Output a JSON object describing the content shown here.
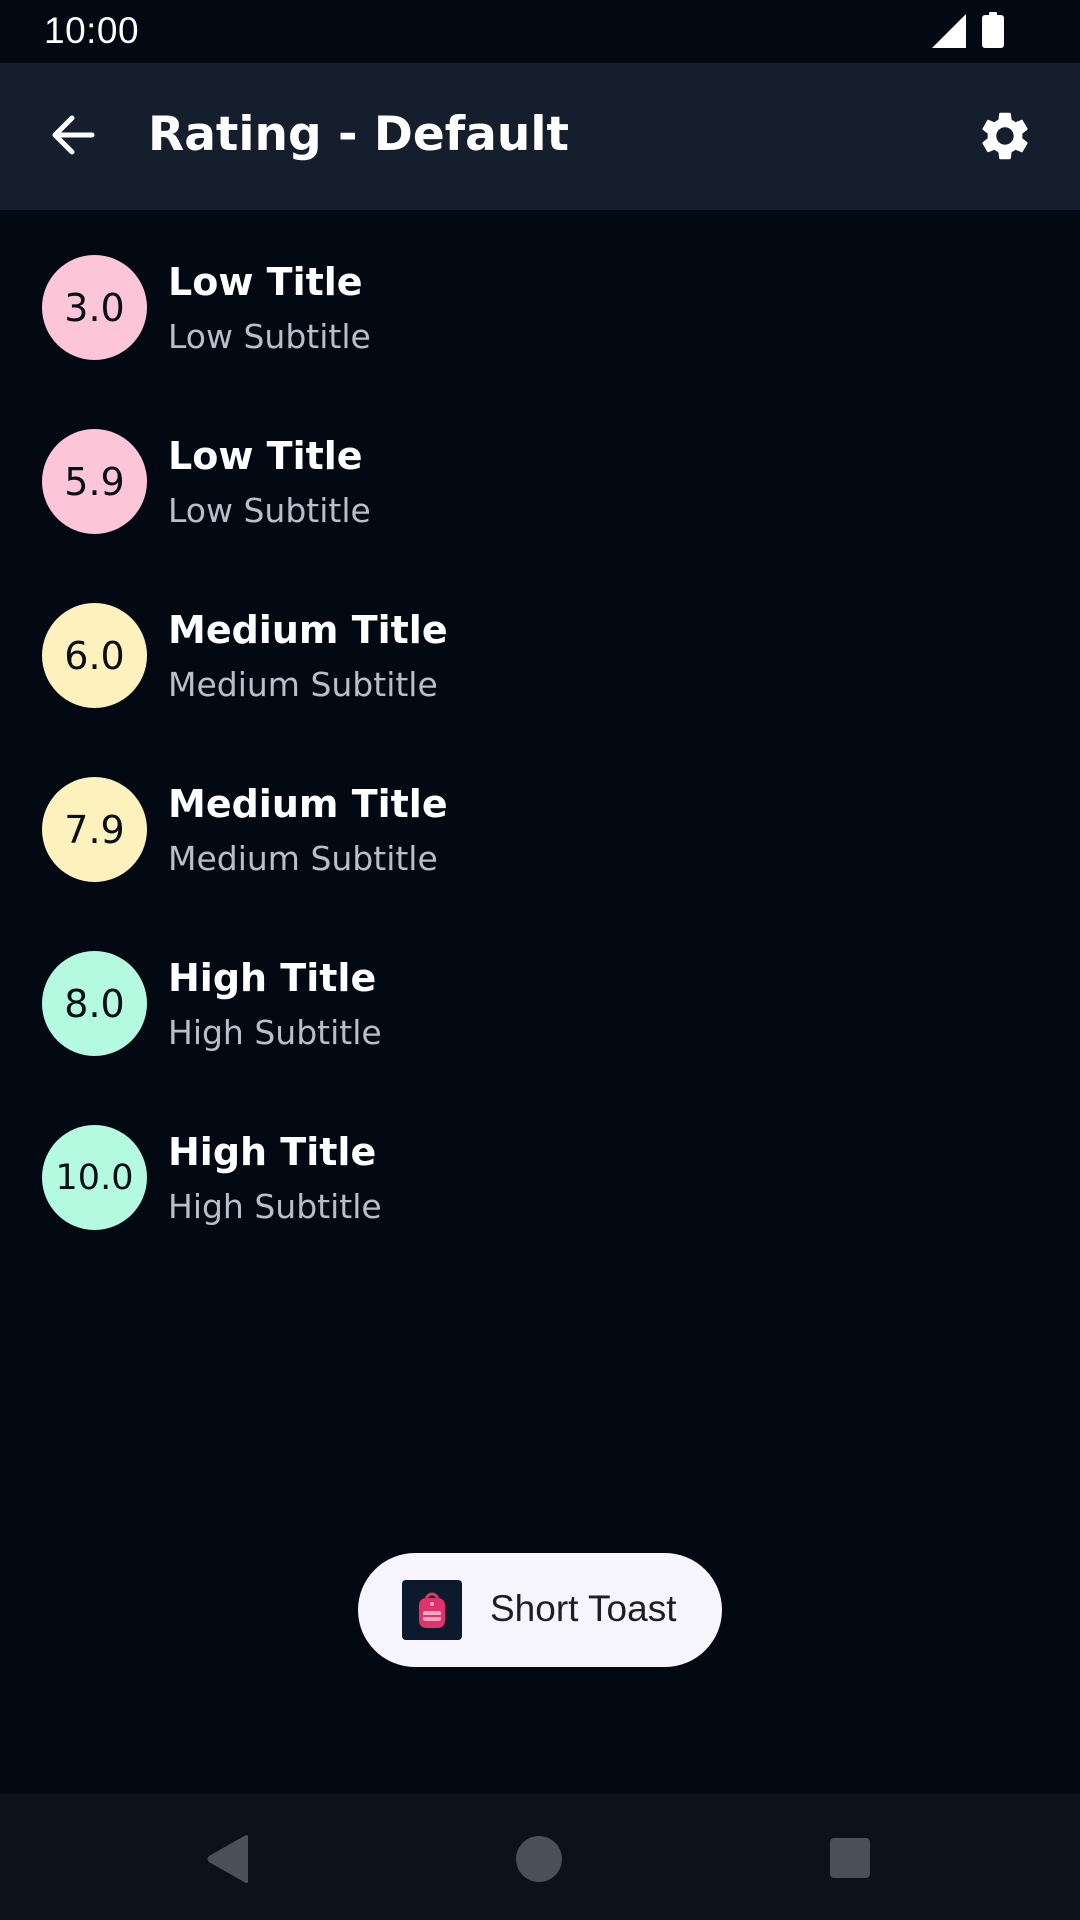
{
  "status_bar": {
    "time": "10:00",
    "icons": [
      "signal-icon",
      "battery-icon"
    ]
  },
  "app_bar": {
    "title": "Rating - Default",
    "icons": [
      "back-arrow-icon",
      "gear-icon"
    ]
  },
  "ratings": [
    {
      "value": "3.0",
      "title": "Low Title",
      "subtitle": "Low Subtitle",
      "level": "low",
      "color": "#fcc5d8"
    },
    {
      "value": "5.9",
      "title": "Low Title",
      "subtitle": "Low Subtitle",
      "level": "low",
      "color": "#fcc5d8"
    },
    {
      "value": "6.0",
      "title": "Medium Title",
      "subtitle": "Medium Subtitle",
      "level": "medium",
      "color": "#fdf1be"
    },
    {
      "value": "7.9",
      "title": "Medium Title",
      "subtitle": "Medium Subtitle",
      "level": "medium",
      "color": "#fdf1be"
    },
    {
      "value": "8.0",
      "title": "High Title",
      "subtitle": "High Subtitle",
      "level": "high",
      "color": "#b3fae0"
    },
    {
      "value": "10.0",
      "title": "High Title",
      "subtitle": "High Subtitle",
      "level": "high",
      "color": "#b3fae0"
    }
  ],
  "toast": {
    "text": "Short Toast",
    "icon": "backpack-icon"
  },
  "nav_bar": {
    "icons": [
      "nav-back-icon",
      "nav-home-icon",
      "nav-recents-icon"
    ]
  },
  "colors": {
    "background": "#020913",
    "app_bar": "#151e2c",
    "subtitle": "#b9bfca",
    "toast_bg": "#f6f5fd",
    "accent_pink": "#e0336e"
  }
}
